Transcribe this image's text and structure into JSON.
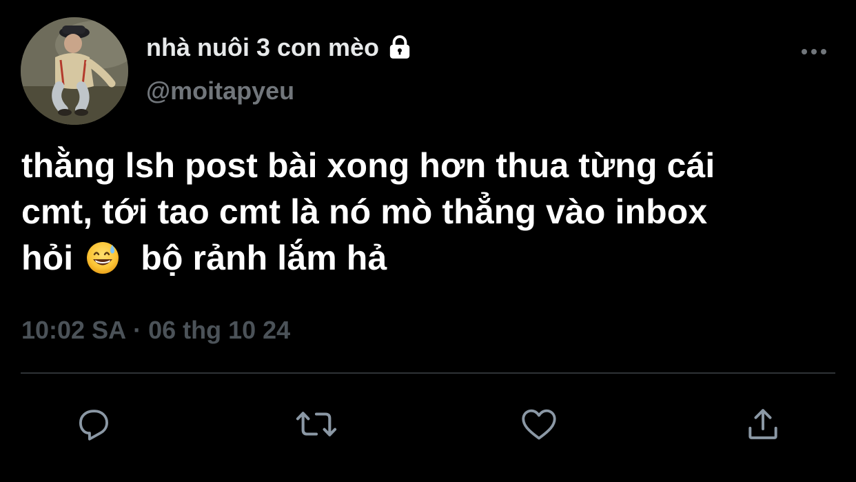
{
  "tweet": {
    "display_name": "nhà nuôi 3 con mèo",
    "handle": "@moitapyeu",
    "protected": true,
    "text_line_1": "thằng lsh post bài xong hơn thua từng cái",
    "text_line_2": "cmt, tới tao cmt là nó mò thẳng vào inbox",
    "text_line_3_before_emoji": "hỏi",
    "emoji": "grinning-face-with-sweat",
    "text_line_3_after_emoji": "bộ rảnh lắm hả",
    "time": "10:02 SA",
    "separator": "·",
    "date": "06 thg 10 24"
  },
  "icons": {
    "lock": "lock-icon",
    "more": "more-horizontal-icon",
    "reply": "reply-icon",
    "retweet": "retweet-icon",
    "like": "heart-icon",
    "share": "share-icon"
  },
  "colors": {
    "background": "#000000",
    "text_primary": "#ffffff",
    "text_secondary": "#71767b",
    "icon": "#8b98a5",
    "divider": "#2f3336"
  }
}
